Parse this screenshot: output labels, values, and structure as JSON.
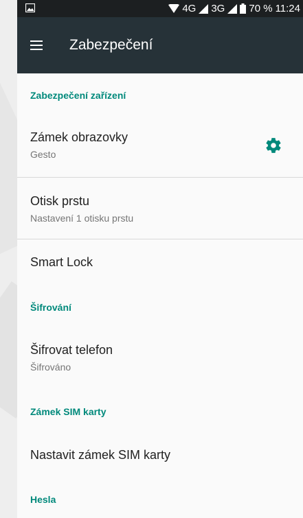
{
  "status_bar": {
    "network_4g": "4G",
    "network_3g": "3G",
    "battery": "70 %",
    "time": "11:24"
  },
  "app_bar": {
    "title": "Zabezpečení"
  },
  "sections": {
    "device_security": "Zabezpečení zařízení",
    "encryption": "Šifrování",
    "sim_lock": "Zámek SIM karty",
    "passwords": "Hesla"
  },
  "items": {
    "screen_lock": {
      "title": "Zámek obrazovky",
      "summary": "Gesto"
    },
    "fingerprint": {
      "title": "Otisk prstu",
      "summary": "Nastavení 1 otisku prstu"
    },
    "smart_lock": {
      "title": "Smart Lock"
    },
    "encrypt_phone": {
      "title": "Šifrovat telefon",
      "summary": "Šifrováno"
    },
    "sim_lock_setup": {
      "title": "Nastavit zámek SIM karty"
    }
  },
  "colors": {
    "accent": "#00897b",
    "app_bar": "#263238",
    "status_bar": "#1c1f21"
  }
}
